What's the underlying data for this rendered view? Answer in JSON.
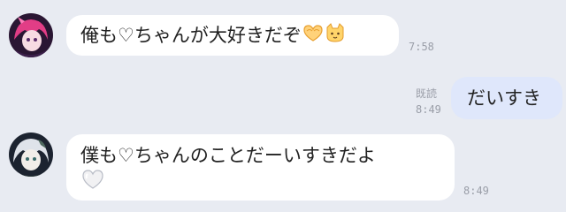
{
  "messages": [
    {
      "side": "them",
      "text": "俺も♡ちゃんが大好きだぞ",
      "emojis": [
        "heart-hands-emoji",
        "cat-face-emoji"
      ],
      "time": "7:58",
      "avatar": "avatar-pink-hair"
    },
    {
      "side": "me",
      "text": "だいすき",
      "read_label": "既読",
      "time": "8:49"
    },
    {
      "side": "them",
      "text": "僕も♡ちゃんのことだーいすきだよ",
      "emojis": [
        "white-heart-emoji"
      ],
      "time": "8:49",
      "avatar": "avatar-white-hair"
    }
  ],
  "colors": {
    "background": "#e8ebf2",
    "bubble_them": "#ffffff",
    "bubble_me": "#dfe7fb",
    "meta_text": "#9a9ea8"
  }
}
